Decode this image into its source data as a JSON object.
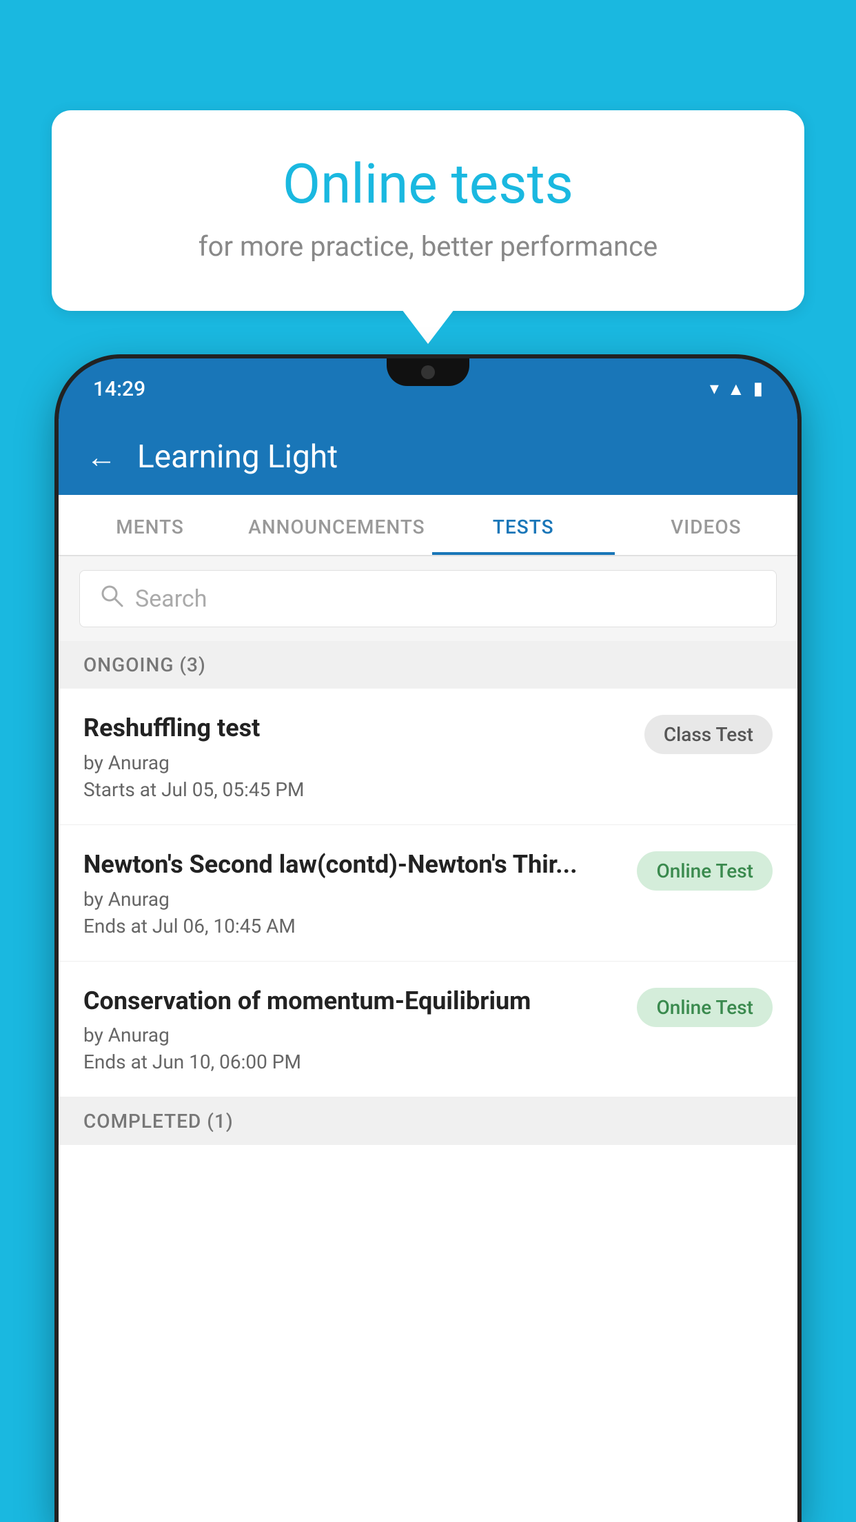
{
  "background": {
    "color": "#1ab8e0"
  },
  "speech_bubble": {
    "title": "Online tests",
    "subtitle": "for more practice, better performance"
  },
  "phone": {
    "status_bar": {
      "time": "14:29"
    },
    "app_header": {
      "title": "Learning Light",
      "back_label": "←"
    },
    "tabs": [
      {
        "label": "MENTS",
        "active": false
      },
      {
        "label": "ANNOUNCEMENTS",
        "active": false
      },
      {
        "label": "TESTS",
        "active": true
      },
      {
        "label": "VIDEOS",
        "active": false
      }
    ],
    "search": {
      "placeholder": "Search"
    },
    "ongoing_section": {
      "label": "ONGOING (3)"
    },
    "tests": [
      {
        "name": "Reshuffling test",
        "author": "by Anurag",
        "date": "Starts at  Jul 05, 05:45 PM",
        "badge": "Class Test",
        "badge_type": "class"
      },
      {
        "name": "Newton's Second law(contd)-Newton's Thir...",
        "author": "by Anurag",
        "date": "Ends at  Jul 06, 10:45 AM",
        "badge": "Online Test",
        "badge_type": "online"
      },
      {
        "name": "Conservation of momentum-Equilibrium",
        "author": "by Anurag",
        "date": "Ends at  Jun 10, 06:00 PM",
        "badge": "Online Test",
        "badge_type": "online"
      }
    ],
    "completed_section": {
      "label": "COMPLETED (1)"
    }
  }
}
